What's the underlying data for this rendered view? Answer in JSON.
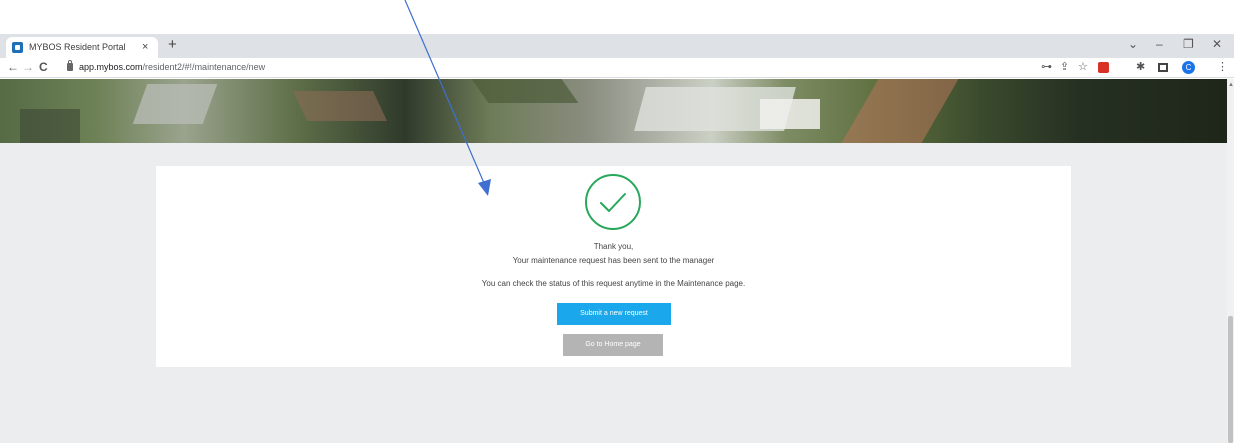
{
  "browser": {
    "tab_title": "MYBOS Resident Portal",
    "tab_close": "×",
    "new_tab": "+",
    "url_domain": "app.mybos.com",
    "url_path": "/resident2/#!/maintenance/new",
    "profile_initial": "C",
    "window_controls": {
      "dropdown": "⌄",
      "minimize": "–",
      "restore": "❐",
      "close": "✕"
    },
    "nav": {
      "back": "←",
      "forward": "→",
      "reload": "C"
    },
    "toolbar_icons": {
      "key": "⊶",
      "share": "⇪",
      "star": "☆",
      "puzzle": "✱",
      "menu": "⋮"
    }
  },
  "confirmation": {
    "thank_you": "Thank you,",
    "sent_message": "Your maintenance request has been sent to the manager",
    "status_message": "You can check the status of this request anytime in the Maintenance page.",
    "submit_new_label": "Submit a new request",
    "home_label": "Go to Home page"
  },
  "colors": {
    "success_green": "#27a85a",
    "primary_button": "#1aa7ec",
    "secondary_button": "#b4b4b4",
    "annotation_arrow": "#3f6fd0"
  }
}
